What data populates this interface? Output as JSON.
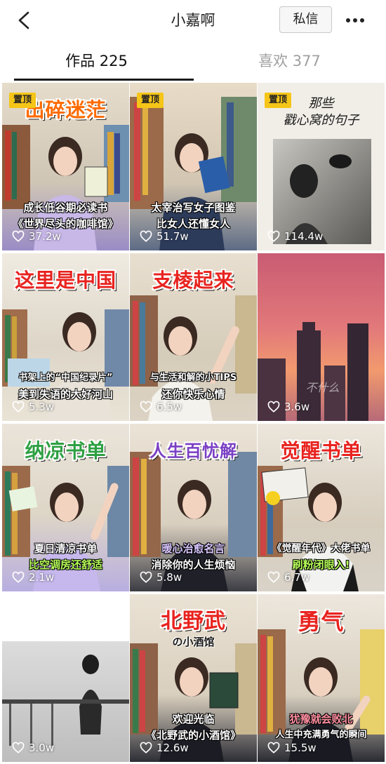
{
  "header": {
    "title": "小嘉啊",
    "message_button": "私信",
    "more_icon": "more-dots-icon",
    "back_icon": "back-chevron-icon"
  },
  "tabs": [
    {
      "label": "作品 225",
      "active": true
    },
    {
      "label": "喜欢 377",
      "active": false
    }
  ],
  "colors": {
    "pin_badge": "#f5c518",
    "active_tab_underline": "#1a1a1a",
    "inactive_tab": "#a0a0a0"
  },
  "videos": [
    {
      "pinned": true,
      "badge": "置顶",
      "title": "出碎迷茫",
      "title_color": "#ff6a00",
      "line1": "成长低谷期必读书",
      "line2": "《世界尽头的咖啡馆》",
      "likes": "37.2w"
    },
    {
      "pinned": true,
      "badge": "置顶",
      "title": "",
      "line1": "太宰治写女子图鉴",
      "line2": "比女人还懂女人",
      "likes": "51.7w"
    },
    {
      "pinned": true,
      "badge": "置顶",
      "title": "",
      "quote": "那些\n戳心窝的句子",
      "likes": "114.4w"
    },
    {
      "pinned": false,
      "title": "这里是中国",
      "title_color": "#e8231f",
      "line1": "书架上的“中国纪录片”",
      "line2": "美到失语的大好河山",
      "likes": "5.3w"
    },
    {
      "pinned": false,
      "title": "支棱起来",
      "title_color": "#e8231f",
      "line1": "与生活和解的小TIPS",
      "line2": "还你快乐心情",
      "likes": "6.5w"
    },
    {
      "pinned": false,
      "title": "",
      "graffiti": "不什么",
      "likes": "3.6w"
    },
    {
      "pinned": false,
      "title": "纳凉书单",
      "title_color": "#2ea043",
      "line1": "夏日清凉书单",
      "line2": "比空调房还舒适",
      "likes": "2.1w"
    },
    {
      "pinned": false,
      "title": "人生百忧解",
      "title_color": "#7a3fc4",
      "line1": "暖心治愈名言",
      "line2": "消除你的人生烦恼",
      "likes": "5.8w"
    },
    {
      "pinned": false,
      "title": "觉醒书单",
      "title_color": "#e8231f",
      "line1": "《觉醒年代》大佬书单",
      "line2": "刷粉闭眼入!",
      "likes": "6.7w"
    },
    {
      "pinned": false,
      "title": "",
      "likes": "3.0w"
    },
    {
      "pinned": false,
      "title": "北野武",
      "subtitle": "の小酒馆",
      "title_color": "#e8231f",
      "line1": "欢迎光临",
      "line2": "《北野武的小酒馆》",
      "likes": "12.6w"
    },
    {
      "pinned": false,
      "title": "勇气",
      "title_color": "#e8231f",
      "line1": "犹豫就会败北",
      "line2": "人生中充满勇气的瞬间",
      "likes": "15.5w"
    }
  ]
}
